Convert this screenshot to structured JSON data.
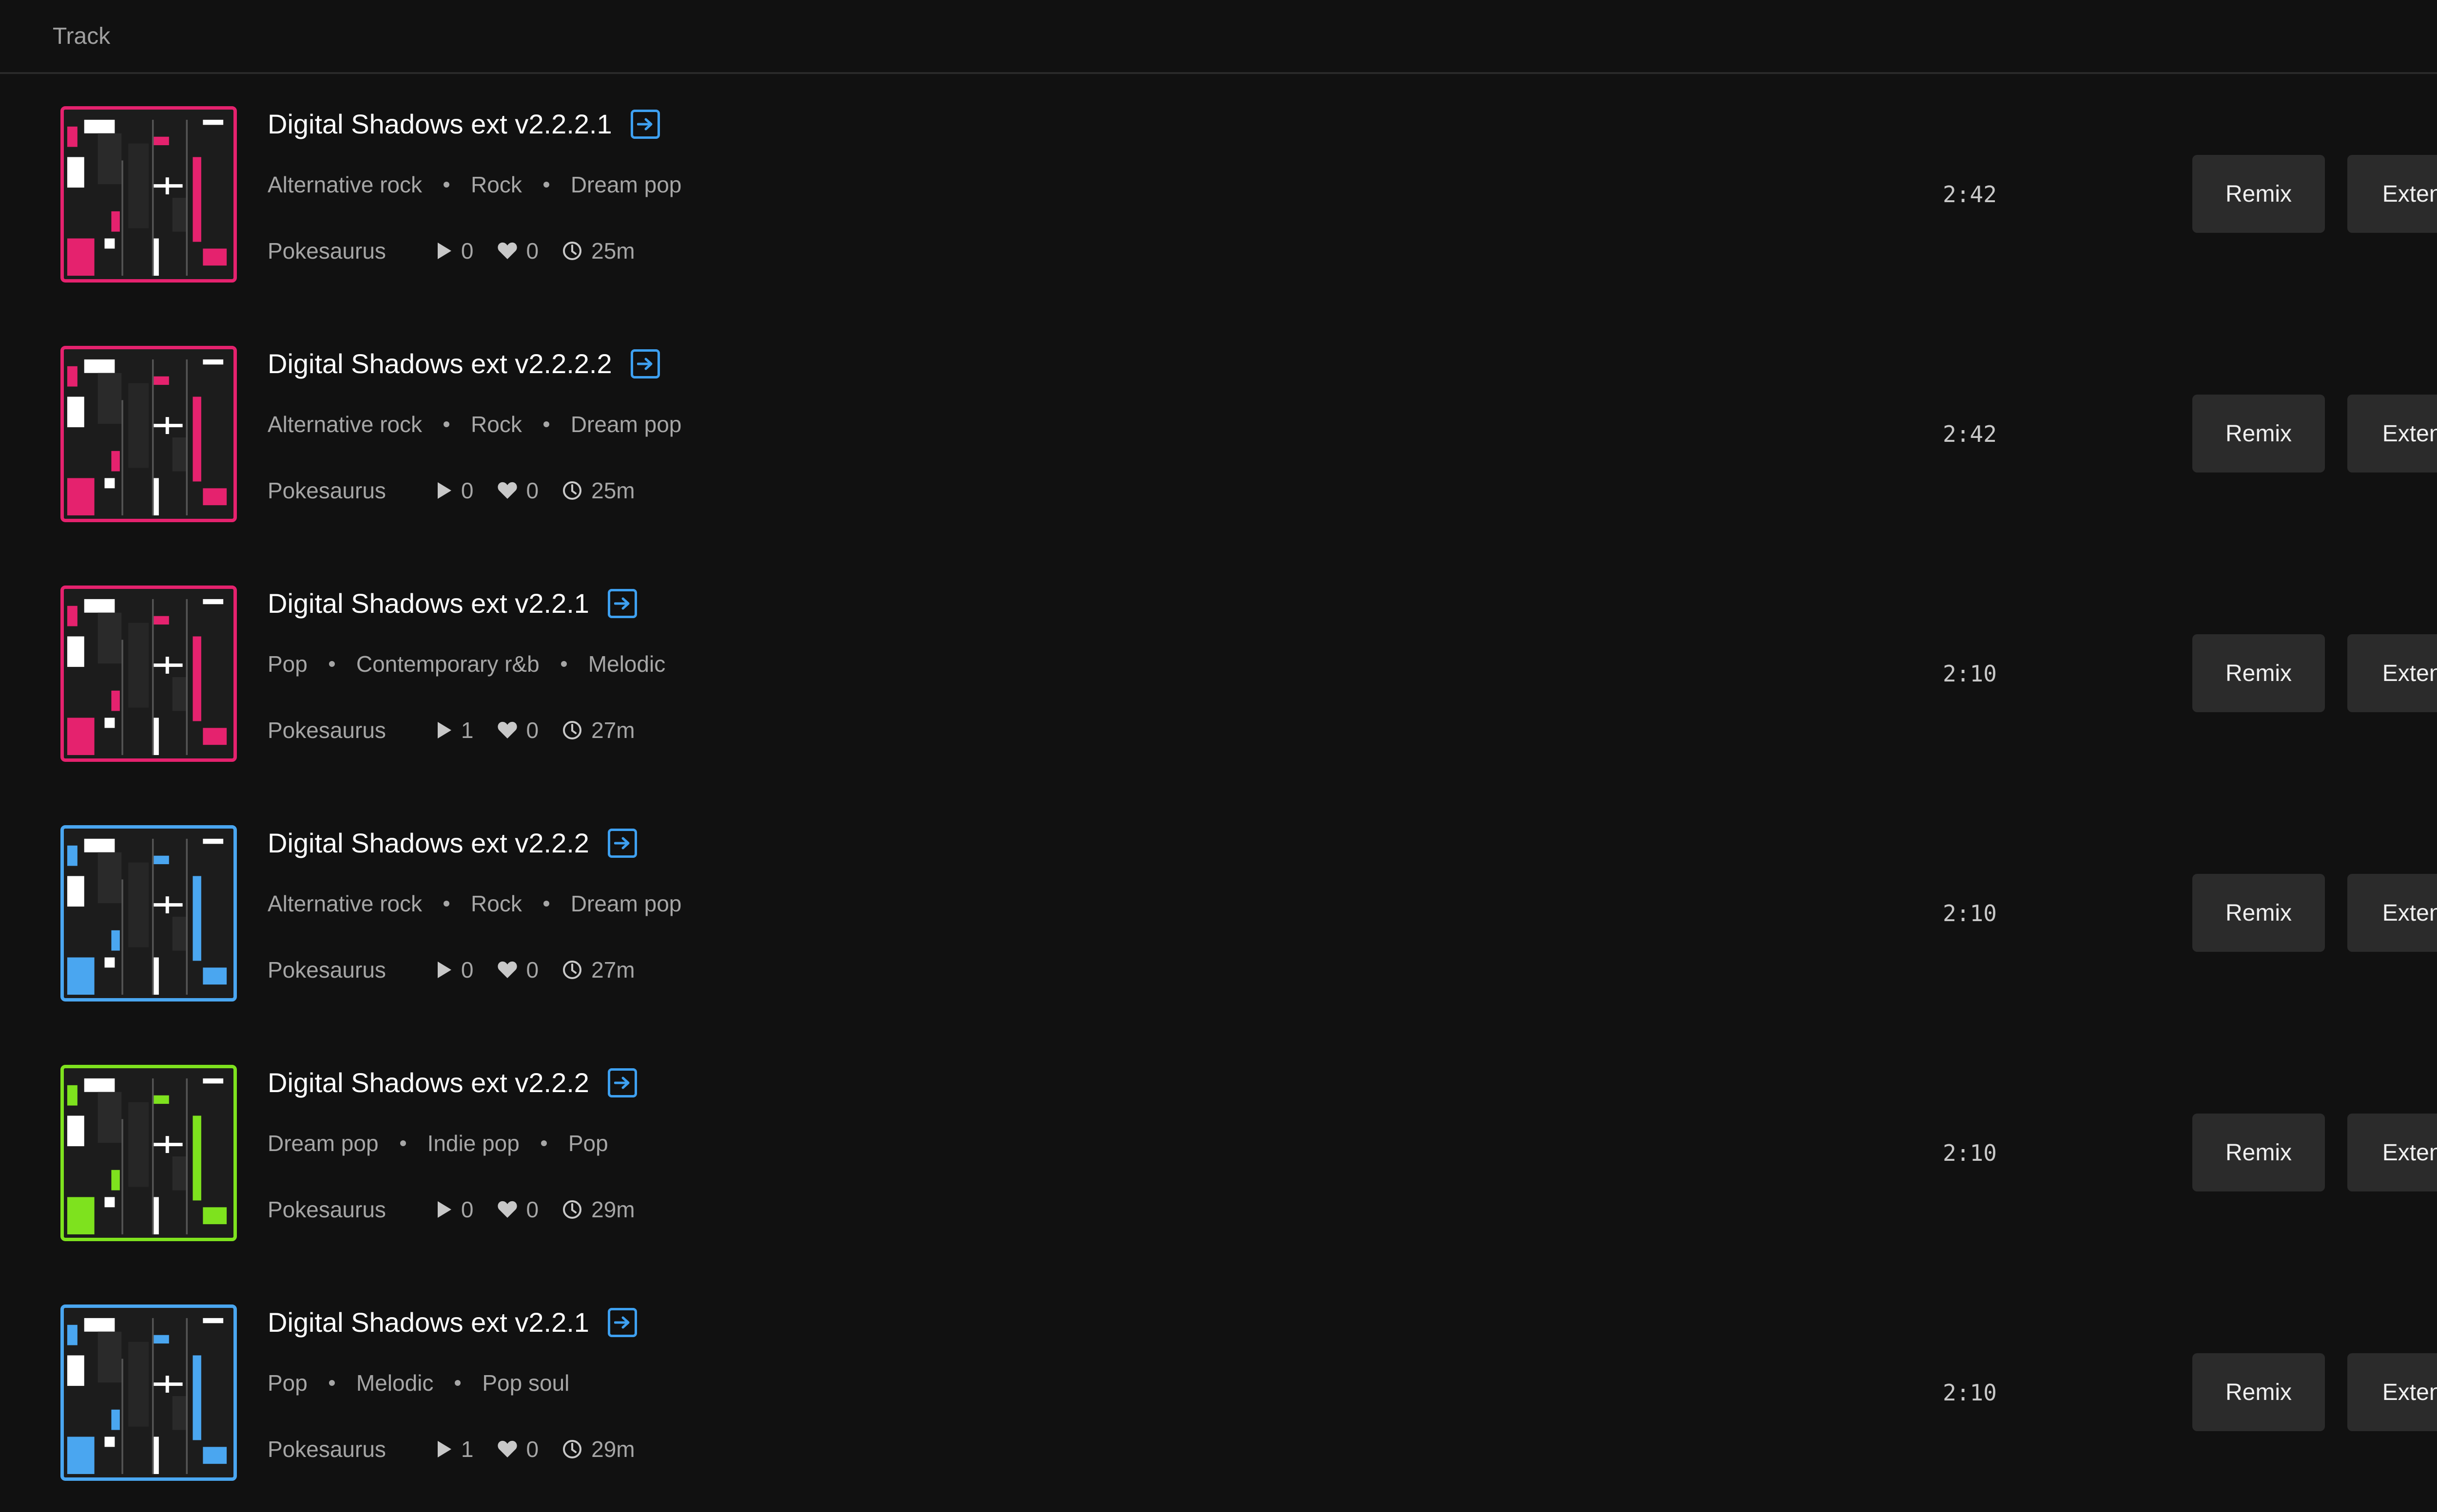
{
  "header": {
    "track_label": "Track"
  },
  "tracks": [
    {
      "title": "Digital Shadows ext v2.2.2.1",
      "tags": [
        "Alternative rock",
        "Rock",
        "Dream pop"
      ],
      "artist": "Pokesaurus",
      "plays": "0",
      "likes": "0",
      "age": "25m",
      "duration": "2:42",
      "remix_label": "Remix",
      "extend_label": "Extend",
      "cover_color": "#e5226e"
    },
    {
      "title": "Digital Shadows ext v2.2.2.2",
      "tags": [
        "Alternative rock",
        "Rock",
        "Dream pop"
      ],
      "artist": "Pokesaurus",
      "plays": "0",
      "likes": "0",
      "age": "25m",
      "duration": "2:42",
      "remix_label": "Remix",
      "extend_label": "Extend",
      "cover_color": "#e5226e"
    },
    {
      "title": "Digital Shadows ext v2.2.1",
      "tags": [
        "Pop",
        "Contemporary r&b",
        "Melodic"
      ],
      "artist": "Pokesaurus",
      "plays": "1",
      "likes": "0",
      "age": "27m",
      "duration": "2:10",
      "remix_label": "Remix",
      "extend_label": "Extend",
      "cover_color": "#e5226e"
    },
    {
      "title": "Digital Shadows ext v2.2.2",
      "tags": [
        "Alternative rock",
        "Rock",
        "Dream pop"
      ],
      "artist": "Pokesaurus",
      "plays": "0",
      "likes": "0",
      "age": "27m",
      "duration": "2:10",
      "remix_label": "Remix",
      "extend_label": "Extend",
      "cover_color": "#4aa6f0"
    },
    {
      "title": "Digital Shadows ext v2.2.2",
      "tags": [
        "Dream pop",
        "Indie pop",
        "Pop"
      ],
      "artist": "Pokesaurus",
      "plays": "0",
      "likes": "0",
      "age": "29m",
      "duration": "2:10",
      "remix_label": "Remix",
      "extend_label": "Extend",
      "cover_color": "#7ee21e"
    },
    {
      "title": "Digital Shadows ext v2.2.1",
      "tags": [
        "Pop",
        "Melodic",
        "Pop soul"
      ],
      "artist": "Pokesaurus",
      "plays": "1",
      "likes": "0",
      "age": "29m",
      "duration": "2:10",
      "remix_label": "Remix",
      "extend_label": "Extend",
      "cover_color": "#4aa6f0"
    }
  ],
  "icons": {
    "open": "arrow-right-square-icon",
    "plays": "play-icon",
    "likes": "heart-icon",
    "age": "clock-icon"
  },
  "colors": {
    "background": "#111111",
    "button": "#2b2b2b",
    "link_icon": "#3ea0f0"
  }
}
